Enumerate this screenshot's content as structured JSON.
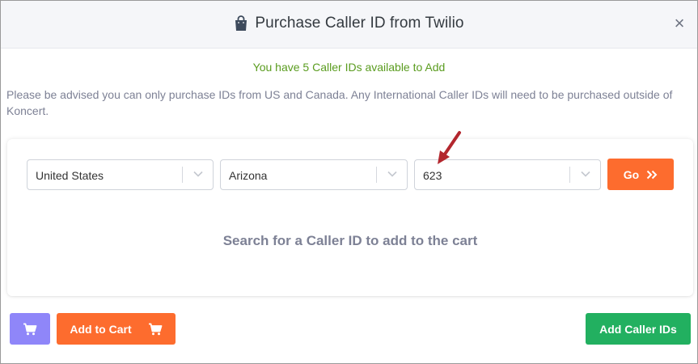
{
  "header": {
    "title": "Purchase Caller ID from Twilio",
    "icon": "shopping-bag-icon",
    "close_label": "×"
  },
  "available_message": "You have 5 Caller IDs available to Add",
  "notice": "Please be advised you can only purchase IDs from US and Canada. Any International Caller IDs will need to be purchased outside of Koncert.",
  "search": {
    "country": "United States",
    "state": "Arizona",
    "area_code": "623",
    "go_label": "Go",
    "empty_message": "Search for a Caller ID to add to the cart"
  },
  "footer": {
    "add_to_cart_label": "Add to Cart",
    "add_caller_ids_label": "Add Caller IDs"
  },
  "colors": {
    "orange": "#fd6c2e",
    "green": "#22b060",
    "purple": "#8f86f9",
    "success_text": "#5a9c1f",
    "annotation_arrow": "#b3272e"
  }
}
